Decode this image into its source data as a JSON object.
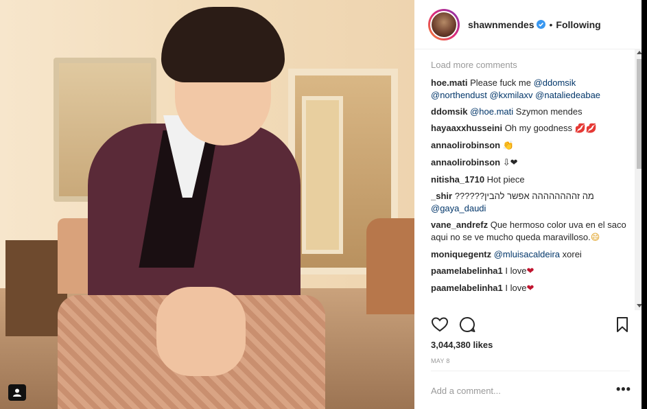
{
  "post": {
    "username": "shawnmendes",
    "follow_status": "Following",
    "separator": "•"
  },
  "comments": {
    "load_more": "Load more comments",
    "items": [
      {
        "user": "hoe.mati",
        "text": "Please fuck me ",
        "mentions": [
          "@ddomsik",
          "@northendust",
          "@kxmilaxv",
          "@nataliedeabae"
        ]
      },
      {
        "user": "ddomsik",
        "mention": "@hoe.mati",
        "text": " Szymon mendes"
      },
      {
        "user": "hayaaxxhusseini",
        "text": "Oh my goodness ",
        "emoji": "💋💋"
      },
      {
        "user": "annaolirobinson",
        "text": " ",
        "emoji": "👏"
      },
      {
        "user": "annaolirobinson",
        "text": " ",
        "emoji": "⇩❤"
      },
      {
        "user": "nitisha_1710",
        "text": "Hot piece"
      },
      {
        "user": "_shir",
        "text": "מה זהההההההה אפשר להבין??????",
        "mention": "@gaya_daudi"
      },
      {
        "user": "vane_andrefz",
        "text": "Que hermoso color uva en el saco aqui no se ve mucho queda maravilloso.",
        "emoji": "😄"
      },
      {
        "user": "moniquegentz",
        "mention": "@mluisacaldeira",
        "text": " xorei"
      },
      {
        "user": "paamelabelinha1",
        "text": "I love",
        "emoji": "❤"
      },
      {
        "user": "paamelabelinha1",
        "text": "I love",
        "emoji": "❤"
      }
    ]
  },
  "likes": "3,044,380 likes",
  "date": "MAY 8",
  "add_comment_placeholder": "Add a comment...",
  "more_options": "•••",
  "icons": {
    "like": "heart-icon",
    "comment": "comment-icon",
    "save": "bookmark-icon",
    "verified": "verified-badge-icon",
    "tag": "user-tag-icon"
  },
  "colors": {
    "mention": "#003569",
    "muted": "#999999",
    "verified": "#3897f0"
  }
}
